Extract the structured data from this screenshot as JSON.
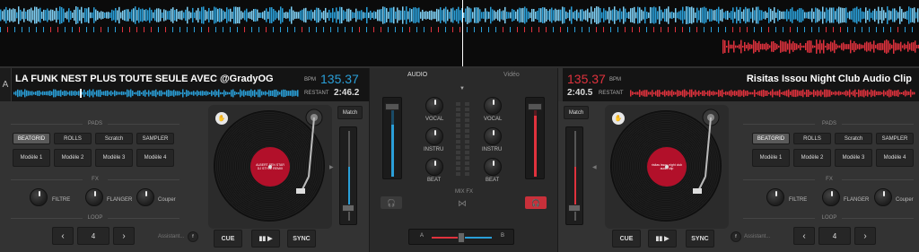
{
  "deck_left": {
    "letter": "A",
    "title": "LA FUNK NEST PLUS TOUTE SEULE AVEC @GradyOG",
    "bpm_label": "BPM",
    "bpm": "135.37",
    "remaining_label": "RESTANT",
    "remaining": "2:46.2",
    "pads_label": "PADS",
    "pad_tabs": [
      "BEATGRID",
      "ROLLS",
      "Scratch",
      "SAMPLER"
    ],
    "pads": [
      "Modèle 1",
      "Modèle 2",
      "Modèle 3",
      "Modèle 4"
    ],
    "fx_label": "FX",
    "fx": [
      "FILTRE",
      "FLANGER",
      "Couper"
    ],
    "loop_label": "LOOP",
    "loop_value": "4",
    "match": "Match",
    "assistant": "Assistant...",
    "cue": "CUE",
    "play": "▮▮ ▶",
    "sync": "SYNC",
    "record_label": "ALBERT SEN STAR DJ STYLE REMIX",
    "accent": "#2a9fd8"
  },
  "deck_right": {
    "title": "Risitas Issou Night Club Audio Clip",
    "bpm_label": "BPM",
    "bpm": "135.37",
    "remaining_label": "RESTANT",
    "remaining": "2:40.5",
    "pads_label": "PADS",
    "pad_tabs": [
      "BEATGRID",
      "ROLLS",
      "Scratch",
      "SAMPLER"
    ],
    "pads": [
      "Modèle 1",
      "Modèle 2",
      "Modèle 3",
      "Modèle 4"
    ],
    "fx_label": "FX",
    "fx": [
      "FILTRE",
      "FLANGER",
      "Couper"
    ],
    "loop_label": "LOOP",
    "loop_value": "4",
    "match": "Match",
    "assistant": "Assistant...",
    "cue": "CUE",
    "play": "▮▮ ▶",
    "sync": "SYNC",
    "record_label": "risitas issou night club audio clip",
    "accent": "#e0323d"
  },
  "mixer": {
    "tab_audio": "AUDIO",
    "tab_video": "Vidéo",
    "eq_left": [
      "VOCAL",
      "INSTRU",
      "BEAT"
    ],
    "eq_right": [
      "VOCAL",
      "INSTRU",
      "BEAT"
    ],
    "mix_fx": "MIX FX",
    "cross_a": "A",
    "cross_b": "B"
  },
  "icons": {
    "headphone": "headphone-icon",
    "prev": "chevron-left-icon",
    "next": "chevron-right-icon"
  }
}
